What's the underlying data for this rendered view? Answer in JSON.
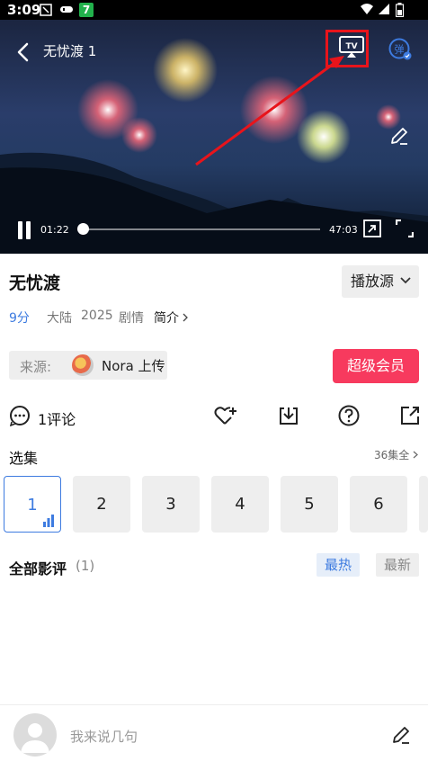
{
  "status": {
    "time": "3:09"
  },
  "player": {
    "title": "无忧渡 1",
    "current_time": "01:22",
    "total_time": "47:03",
    "progress": 0.029,
    "tv_label": "TV",
    "danmu_label": "弹"
  },
  "info": {
    "title": "无忧渡",
    "source_button": "播放源",
    "score": "9分",
    "region": "大陆",
    "year": "2025",
    "genre": "剧情",
    "intro": "简介",
    "uploader_label": "来源:",
    "uploader_name": "Nora 上传",
    "vip_button": "超级会员",
    "comments": "1评论"
  },
  "episodes": {
    "title": "选集",
    "all": "36集全",
    "items": [
      "1",
      "2",
      "3",
      "4",
      "5",
      "6"
    ]
  },
  "reviews": {
    "title": "全部影评",
    "count": "(1)",
    "hot": "最热",
    "new": "最新"
  },
  "composer": {
    "placeholder": "我来说几句"
  },
  "colors": {
    "accent": "#3d7be0",
    "vip": "#f73a5e",
    "highlight": "#e8141b"
  }
}
